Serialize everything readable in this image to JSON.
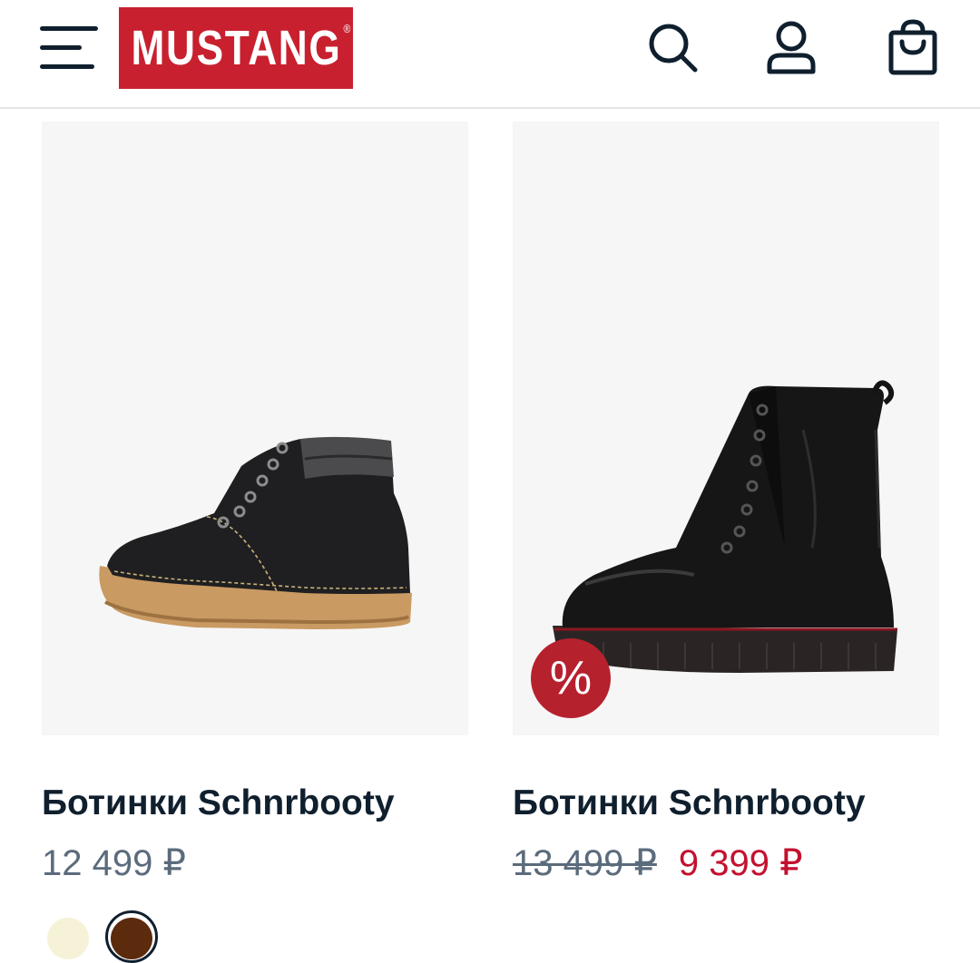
{
  "header": {
    "brand": "MUSTANG",
    "brand_reg": "®",
    "icons": [
      "menu-icon",
      "search-icon",
      "user-icon",
      "bag-icon"
    ]
  },
  "products": [
    {
      "title": "Ботинки Schnrbooty",
      "price": "12 499 ₽",
      "swatches": [
        "#f6f2d8",
        "#5c2a0c"
      ],
      "selected_swatch": 1
    },
    {
      "title": "Ботинки Schnrbooty",
      "price_old": "13 499 ₽",
      "price_new": "9 399 ₽",
      "badge": "%"
    }
  ],
  "colors": {
    "brand_red": "#c8202f",
    "sale_red": "#c3112f",
    "text_dark": "#0f1f2e",
    "text_muted": "#5b6b7c"
  }
}
